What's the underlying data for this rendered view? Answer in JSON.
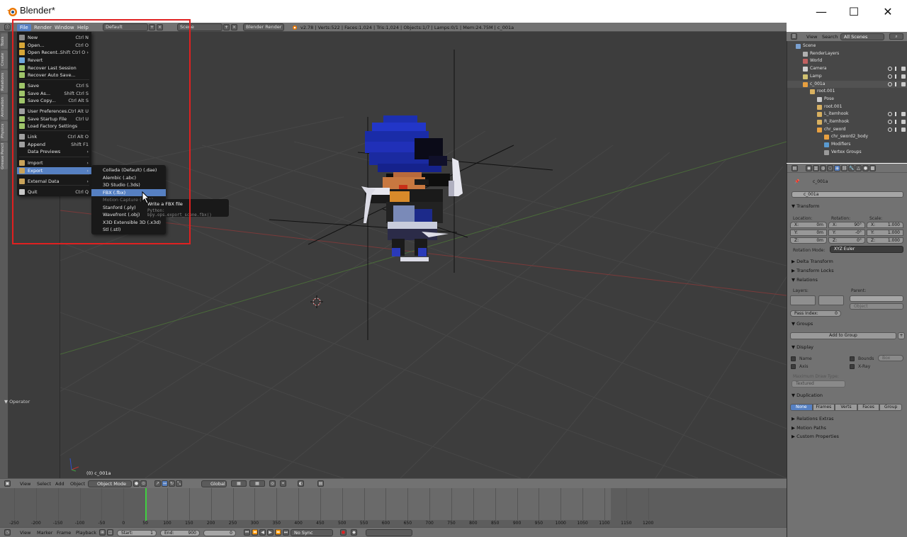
{
  "window": {
    "title": "Blender*",
    "minimize": "—",
    "maximize": "☐",
    "close": "✕"
  },
  "infobar": {
    "menus": [
      "File",
      "Render",
      "Window",
      "Help"
    ],
    "layout": "Default",
    "scene": "Scene",
    "engine": "Blender Render",
    "stats": "v2.78 | Verts:522 | Faces:1,024 | Tris:1,024 | Objects:1/7 | Lamps:0/1 | Mem:24.75M | c_001a"
  },
  "toolstrip": {
    "tabs": [
      "Tools",
      "Create",
      "Relations",
      "Animation",
      "Physics",
      "Grease Pencil"
    ]
  },
  "toolshelf": {
    "operator": "▼ Operator"
  },
  "file_menu": {
    "items": [
      {
        "label": "New",
        "shortcut": "Ctrl N"
      },
      {
        "label": "Open...",
        "shortcut": "Ctrl O"
      },
      {
        "label": "Open Recent...",
        "shortcut": "Shift Ctrl O  ›"
      },
      {
        "label": "Revert",
        "shortcut": ""
      },
      {
        "label": "Recover Last Session",
        "shortcut": ""
      },
      {
        "label": "Recover Auto Save...",
        "shortcut": ""
      },
      {
        "label": "Save",
        "shortcut": "Ctrl S"
      },
      {
        "label": "Save As...",
        "shortcut": "Shift Ctrl S"
      },
      {
        "label": "Save Copy...",
        "shortcut": "Ctrl Alt S"
      },
      {
        "label": "User Preferences...",
        "shortcut": "Ctrl Alt U"
      },
      {
        "label": "Save Startup File",
        "shortcut": "Ctrl U"
      },
      {
        "label": "Load Factory Settings",
        "shortcut": ""
      },
      {
        "label": "Link",
        "shortcut": "Ctrl Alt O"
      },
      {
        "label": "Append",
        "shortcut": "Shift F1"
      },
      {
        "label": "Data Previews",
        "shortcut": "›"
      },
      {
        "label": "Import",
        "shortcut": "›"
      },
      {
        "label": "Export",
        "shortcut": "›"
      },
      {
        "label": "External Data",
        "shortcut": "›"
      },
      {
        "label": "Quit",
        "shortcut": "Ctrl Q"
      }
    ]
  },
  "export_menu": {
    "items": [
      "Collada (Default) (.dae)",
      "Alembic (.abc)",
      "3D Studio (.3ds)",
      "FBX (.fbx)",
      "Motion Capture (.bvh)",
      "Stanford (.ply)",
      "Wavefront (.obj)",
      "X3D Extensible 3D (.x3d)",
      "Stl (.stl)"
    ]
  },
  "tooltip": {
    "title": "Write a FBX file",
    "python": "Python: bpy.ops.export_scene.fbx()"
  },
  "viewport": {
    "object_label": "(0) c_001a"
  },
  "viewport_header": {
    "view": "View",
    "select": "Select",
    "add": "Add",
    "object": "Object",
    "mode": "Object Mode",
    "orientation": "Global"
  },
  "timeline": {
    "ticks": [
      "-250",
      "-200",
      "-150",
      "-100",
      "-50",
      "0",
      "50",
      "100",
      "150",
      "200",
      "250",
      "300",
      "350",
      "400",
      "450",
      "500",
      "550",
      "600",
      "650",
      "700",
      "750",
      "800",
      "850",
      "900",
      "950",
      "1000",
      "1050",
      "1100",
      "1150",
      "1200"
    ],
    "view": "View",
    "marker": "Marker",
    "frame": "Frame",
    "playback": "Playback",
    "start": "Start:",
    "start_val": "1",
    "end": "End:",
    "end_val": "900",
    "current": "0",
    "sync": "No Sync"
  },
  "outliner": {
    "view": "View",
    "search": "Search",
    "filter": "All Scenes",
    "rows": [
      {
        "label": "Scene",
        "indent": 0
      },
      {
        "label": "RenderLayers",
        "indent": 1
      },
      {
        "label": "World",
        "indent": 1
      },
      {
        "label": "Camera",
        "indent": 1
      },
      {
        "label": "Lamp",
        "indent": 1
      },
      {
        "label": "c_001a",
        "indent": 1
      },
      {
        "label": "root.001",
        "indent": 2
      },
      {
        "label": "Pose",
        "indent": 3
      },
      {
        "label": "root.001",
        "indent": 3
      },
      {
        "label": "L_itemhook",
        "indent": 3
      },
      {
        "label": "R_itemhook",
        "indent": 3
      },
      {
        "label": "chr_sword",
        "indent": 3
      },
      {
        "label": "chr_sword2_body",
        "indent": 4
      },
      {
        "label": "Modifiers",
        "indent": 4
      },
      {
        "label": "Vertex Groups",
        "indent": 4
      }
    ]
  },
  "properties": {
    "context": "c_001a",
    "name": "c_001a",
    "transform": "▼ Transform",
    "location": "Location:",
    "rotation": "Rotation:",
    "scale": "Scale:",
    "loc": [
      {
        "a": "X:",
        "v": "0m"
      },
      {
        "a": "Y:",
        "v": "0m"
      },
      {
        "a": "Z:",
        "v": "0m"
      }
    ],
    "rot": [
      {
        "a": "X:",
        "v": "90°"
      },
      {
        "a": "Y:",
        "v": "-0°"
      },
      {
        "a": "Z:",
        "v": "0°"
      }
    ],
    "scl": [
      {
        "a": "X:",
        "v": "1.000"
      },
      {
        "a": "Y:",
        "v": "1.000"
      },
      {
        "a": "Z:",
        "v": "1.000"
      }
    ],
    "rotation_mode_label": "Rotation Mode:",
    "rotation_mode": "XYZ Euler",
    "delta": "▶ Delta Transform",
    "locks": "▶ Transform Locks",
    "relations": "▼ Relations",
    "layers": "Layers:",
    "parent": "Parent:",
    "parent_type": "Object",
    "pass_index": "Pass Index:",
    "pass_index_val": "0",
    "groups": "▼ Groups",
    "add_to_group": "Add to Group",
    "display": "▼ Display",
    "name_chk": "Name",
    "axis_chk": "Axis",
    "bounds_chk": "Bounds",
    "bounds_type": "Box",
    "xray_chk": "X-Ray",
    "max_draw": "Maximum Draw Type:",
    "max_draw_val": "Textured",
    "duplication": "▼ Duplication",
    "dup_buttons": [
      "None",
      "Frames",
      "Verts",
      "Faces",
      "Group"
    ],
    "rel_extras": "▶ Relations Extras",
    "motion_paths": "▶ Motion Paths",
    "custom_props": "▶ Custom Properties"
  },
  "colors": {
    "accent": "#5680c2",
    "highlight_box": "#e02020",
    "viewport_bg": "#3d3d3d",
    "header_bg": "#727272"
  }
}
